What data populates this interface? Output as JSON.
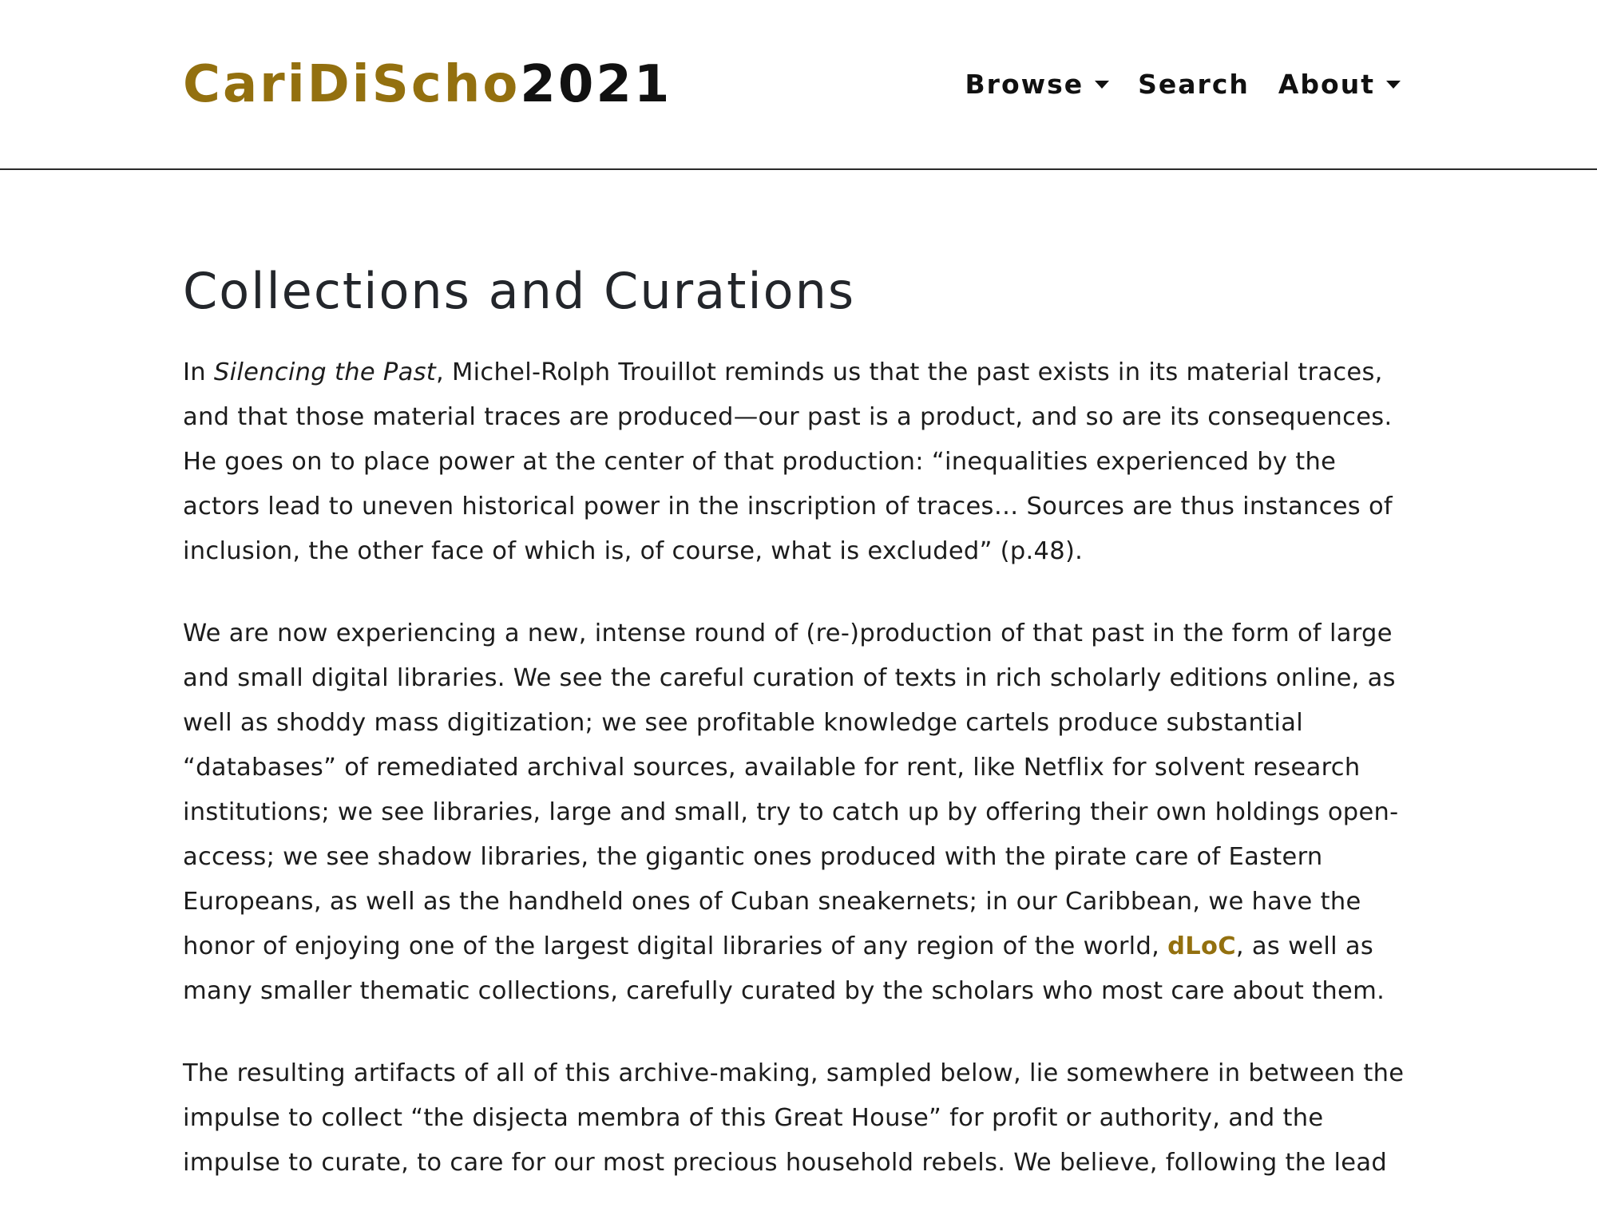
{
  "header": {
    "brand_part1": "CariDiScho",
    "brand_part2": "2021",
    "nav": {
      "browse": "Browse",
      "search": "Search",
      "about": "About"
    }
  },
  "colors": {
    "accent": "#93700f",
    "text": "#1c1c1c"
  },
  "icons": [
    "caret-down-icon"
  ],
  "main": {
    "title": "Collections and Curations",
    "p1": {
      "pre": "In ",
      "book_title": "Silencing the Past",
      "post": ", Michel-Rolph Trouillot reminds us that the past exists in its material traces, and that those material traces are produced—our past is a product, and so are its consequences. He goes on to place power at the center of that production: “inequalities experienced by the actors lead to uneven historical power in the inscription of traces… Sources are thus instances of inclusion, the other face of which is, of course, what is excluded” (p.48)."
    },
    "p2": {
      "pre": "We are now experiencing a new, intense round of (re-)production of that past in the form of large and small digital libraries. We see the careful curation of texts in rich scholarly editions online, as well as shoddy mass digitization; we see profitable knowledge cartels produce substantial “databases” of remediated archival sources, available for rent, like Netflix for solvent research institutions; we see libraries, large and small, try to catch up by offering their own holdings open-access; we see shadow libraries, the gigantic ones produced with the pirate care of Eastern Europeans, as well as the handheld ones of Cuban sneakernets; in our Caribbean, we have the honor of enjoying one of the largest digital libraries of any region of the world, ",
      "link": "dLoC",
      "post": ", as well as many smaller thematic collections, carefully curated by the scholars who most care about them."
    },
    "p3": "The resulting artifacts of all of this archive-making, sampled below, lie somewhere in between the impulse to collect “the disjecta membra of this Great House” for profit or authority, and the impulse to curate, to care for our most precious household rebels. We believe, following the lead"
  }
}
